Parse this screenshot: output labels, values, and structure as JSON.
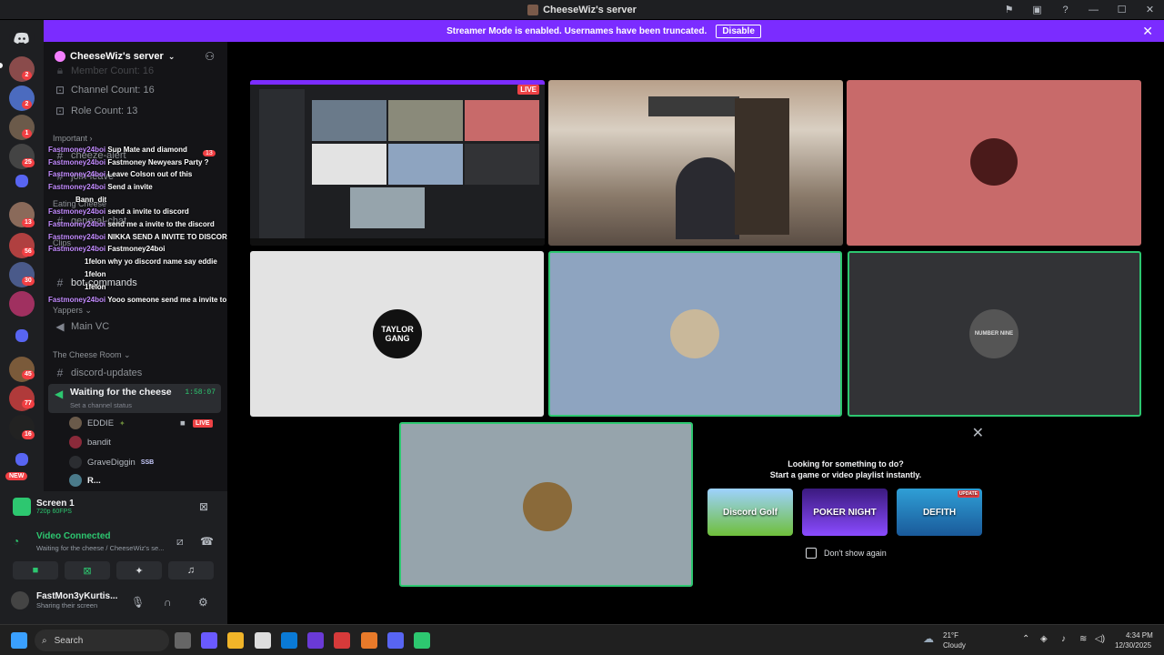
{
  "window": {
    "title": "CheeseWiz's server",
    "controls": [
      "minimize",
      "maximize",
      "close"
    ]
  },
  "banner": {
    "text": "Streamer Mode is enabled. Usernames have been truncated.",
    "button": "Disable"
  },
  "guilds": {
    "badges": [
      "2",
      "2",
      "1",
      "25",
      "13",
      "56",
      "30",
      "45",
      "77",
      "16"
    ],
    "new_label": "NEW"
  },
  "server": {
    "name": "CheeseWiz's server"
  },
  "channels": {
    "truncated_top": "Member Count: 16",
    "channel_count": "Channel Count: 16",
    "role_count": "Role Count: 13",
    "cat_important": "Important",
    "cheeze_alert": "cheeze-alert",
    "cheeze_alert_badge": "13",
    "join_leave": "join-leave",
    "cat_eating": "Eating Cheese",
    "general_chat": "general-chat",
    "cat_clips": "Clips",
    "bot_commands": "bot-commands",
    "cat_yappers": "Yappers",
    "main_vc": "Main VC",
    "cat_cheese_room": "The Cheese Room",
    "discord_updates": "discord-updates",
    "vc_name": "Waiting for the cheese",
    "vc_time": "1:58:07",
    "vc_status": "Set a channel status",
    "vc_users": [
      {
        "name": "EDDIE",
        "live": "LIVE"
      },
      {
        "name": "bandit"
      },
      {
        "name": "GraveDiggin",
        "tag": "SSB"
      },
      {
        "name": "R..."
      }
    ]
  },
  "overlay_chat": [
    {
      "name": "Fastmoney24boi",
      "msg": "Sup Mate and diamond"
    },
    {
      "name": "Fastmoney24boi",
      "msg": "Fastmoney Newyears Party ?"
    },
    {
      "name": "Fastmoney24boi",
      "msg": "Leave Colson out of this"
    },
    {
      "name": "Fastmoney24boi",
      "msg": "Send a invite"
    },
    {
      "name": "Bann_dit",
      "msg": ""
    },
    {
      "name": "Fastmoney24boi",
      "msg": "send a invite to discord"
    },
    {
      "name": "Fastmoney24boi",
      "msg": "send me a invite to the discord"
    },
    {
      "name": "Fastmoney24boi",
      "msg": "NIKKA SEND A INVITE TO DISCORD"
    },
    {
      "name": "Fastmoney24boi",
      "msg": "Fastmoney24boi"
    },
    {
      "name": "1felon",
      "msg": "why yo discord name say eddie"
    },
    {
      "name": "1felon",
      "msg": ""
    },
    {
      "name": "1felon",
      "msg": ""
    },
    {
      "name": "Fastmoney24boi",
      "msg": "Yooo someone send me a invite to the discord all"
    }
  ],
  "voice": {
    "screen_title": "Screen 1",
    "screen_sub": "720p 60FPS",
    "connected": "Video Connected",
    "connected_sub": "Waiting for the cheese / CheeseWiz's se..."
  },
  "user": {
    "name": "FastMon3yKurtis...",
    "status": "Sharing their screen"
  },
  "stage": {
    "live": "LIVE",
    "tile4_text": "TAYLOR GANG",
    "tile6_text": "NUMBER NINE"
  },
  "activity": {
    "line1": "Looking for something to do?",
    "line2": "Start a game or video playlist instantly.",
    "games": [
      {
        "name": "Discord Golf",
        "color": "#6fbf3a"
      },
      {
        "name": "POKER NIGHT",
        "color": "#6b3bbf"
      },
      {
        "name": "DEFITH",
        "color": "#2f9fd6"
      }
    ],
    "update_badge": "UPDATE",
    "dont_show": "Don't show again"
  },
  "taskbar": {
    "search": "Search",
    "weather_temp": "21°F",
    "weather_desc": "Cloudy",
    "time": "4:34 PM",
    "date": "12/30/2025"
  },
  "colors": {
    "accent": "#7b2cff",
    "green": "#2dc770",
    "red": "#ed4245"
  }
}
